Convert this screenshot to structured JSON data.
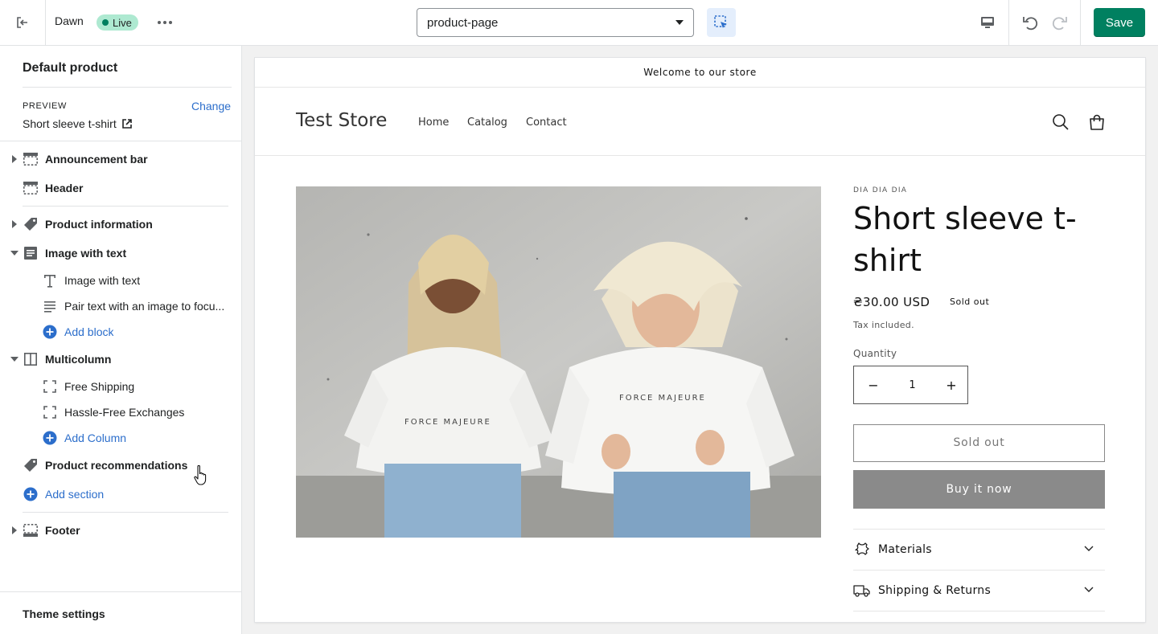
{
  "topbar": {
    "theme_name": "Dawn",
    "live_badge": "Live",
    "template_select": "product-page",
    "save_label": "Save"
  },
  "sidebar": {
    "title": "Default product",
    "preview_label": "PREVIEW",
    "change_link": "Change",
    "preview_product": "Short sleeve t-shirt",
    "items": [
      {
        "label": "Announcement bar"
      },
      {
        "label": "Header"
      },
      {
        "label": "Product information"
      },
      {
        "label": "Image with text"
      },
      {
        "label": "Image with text"
      },
      {
        "label": "Pair text with an image to focu..."
      },
      {
        "label": "Add block"
      },
      {
        "label": "Multicolumn"
      },
      {
        "label": "Free Shipping"
      },
      {
        "label": "Hassle-Free Exchanges"
      },
      {
        "label": "Add Column"
      },
      {
        "label": "Product recommendations"
      },
      {
        "label": "Add section"
      },
      {
        "label": "Footer"
      }
    ],
    "theme_settings": "Theme settings"
  },
  "preview": {
    "announcement": "Welcome to our store",
    "store_name": "Test Store",
    "nav": [
      "Home",
      "Catalog",
      "Contact"
    ],
    "vendor": "DIA DIA DIA",
    "product_title": "Short sleeve t-shirt",
    "price": "₴30.00 USD",
    "sold_badge": "Sold out",
    "tax_note": "Tax included.",
    "quantity_label": "Quantity",
    "quantity_value": "1",
    "sold_out_button": "Sold out",
    "buy_now_button": "Buy it now",
    "accordions": [
      {
        "label": "Materials"
      },
      {
        "label": "Shipping & Returns"
      }
    ]
  },
  "colors": {
    "accent_green": "#008060",
    "link_blue": "#2c6ecb",
    "live_badge_bg": "#aee9d1",
    "buy_now_bg": "#8a8a8a"
  }
}
